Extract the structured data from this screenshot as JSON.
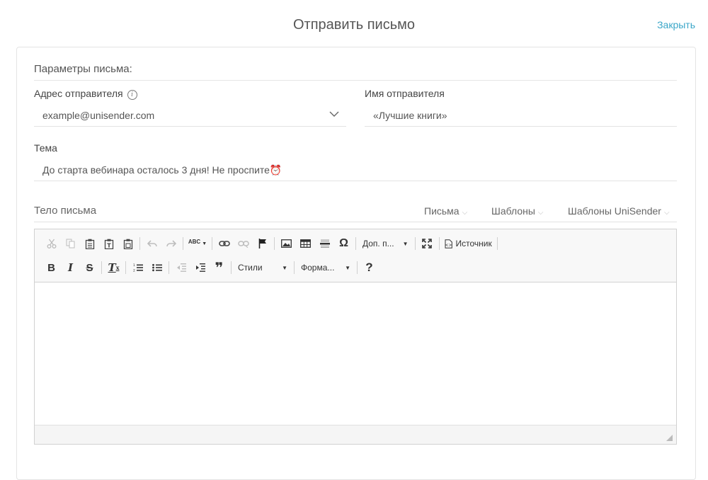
{
  "header": {
    "title": "Отправить письмо",
    "close_label": "Закрыть"
  },
  "params": {
    "section_title": "Параметры письма:",
    "sender_address_label": "Адрес отправителя",
    "sender_address_value": "example@unisender.com",
    "sender_name_label": "Имя отправителя",
    "sender_name_value": "«Лучшие книги»",
    "subject_label": "Тема",
    "subject_value": "До старта вебинара осталось 3 дня! Не проспите⏰"
  },
  "body": {
    "title": "Тело письма",
    "menus": {
      "letters": "Письма",
      "templates": "Шаблоны",
      "unisender_templates": "Шаблоны UniSender"
    }
  },
  "toolbar": {
    "spell_label": "ABC",
    "extra_combo": "Доп. п...",
    "source_label": "Источник",
    "styles_combo": "Стили",
    "format_combo": "Форма...",
    "bold": "B",
    "italic": "I",
    "strike": "S",
    "clear": "T",
    "quote": "❞",
    "help": "?",
    "omega": "Ω",
    "icons": [
      "cut-icon",
      "copy-icon",
      "paste-icon",
      "paste-text-icon",
      "paste-word-icon",
      "undo-icon",
      "redo-icon",
      "spellcheck-icon",
      "link-icon",
      "unlink-icon",
      "anchor-icon",
      "image-icon",
      "table-icon",
      "horizontal-line-icon",
      "special-char-icon",
      "maximize-icon",
      "source-icon",
      "bold-icon",
      "italic-icon",
      "strike-icon",
      "remove-format-icon",
      "numbered-list-icon",
      "bullet-list-icon",
      "outdent-icon",
      "indent-icon",
      "blockquote-icon",
      "help-icon"
    ]
  },
  "colors": {
    "accent": "#3aa6c8",
    "border": "#d1d1d1",
    "toolbar_bg": "#f8f8f8"
  }
}
